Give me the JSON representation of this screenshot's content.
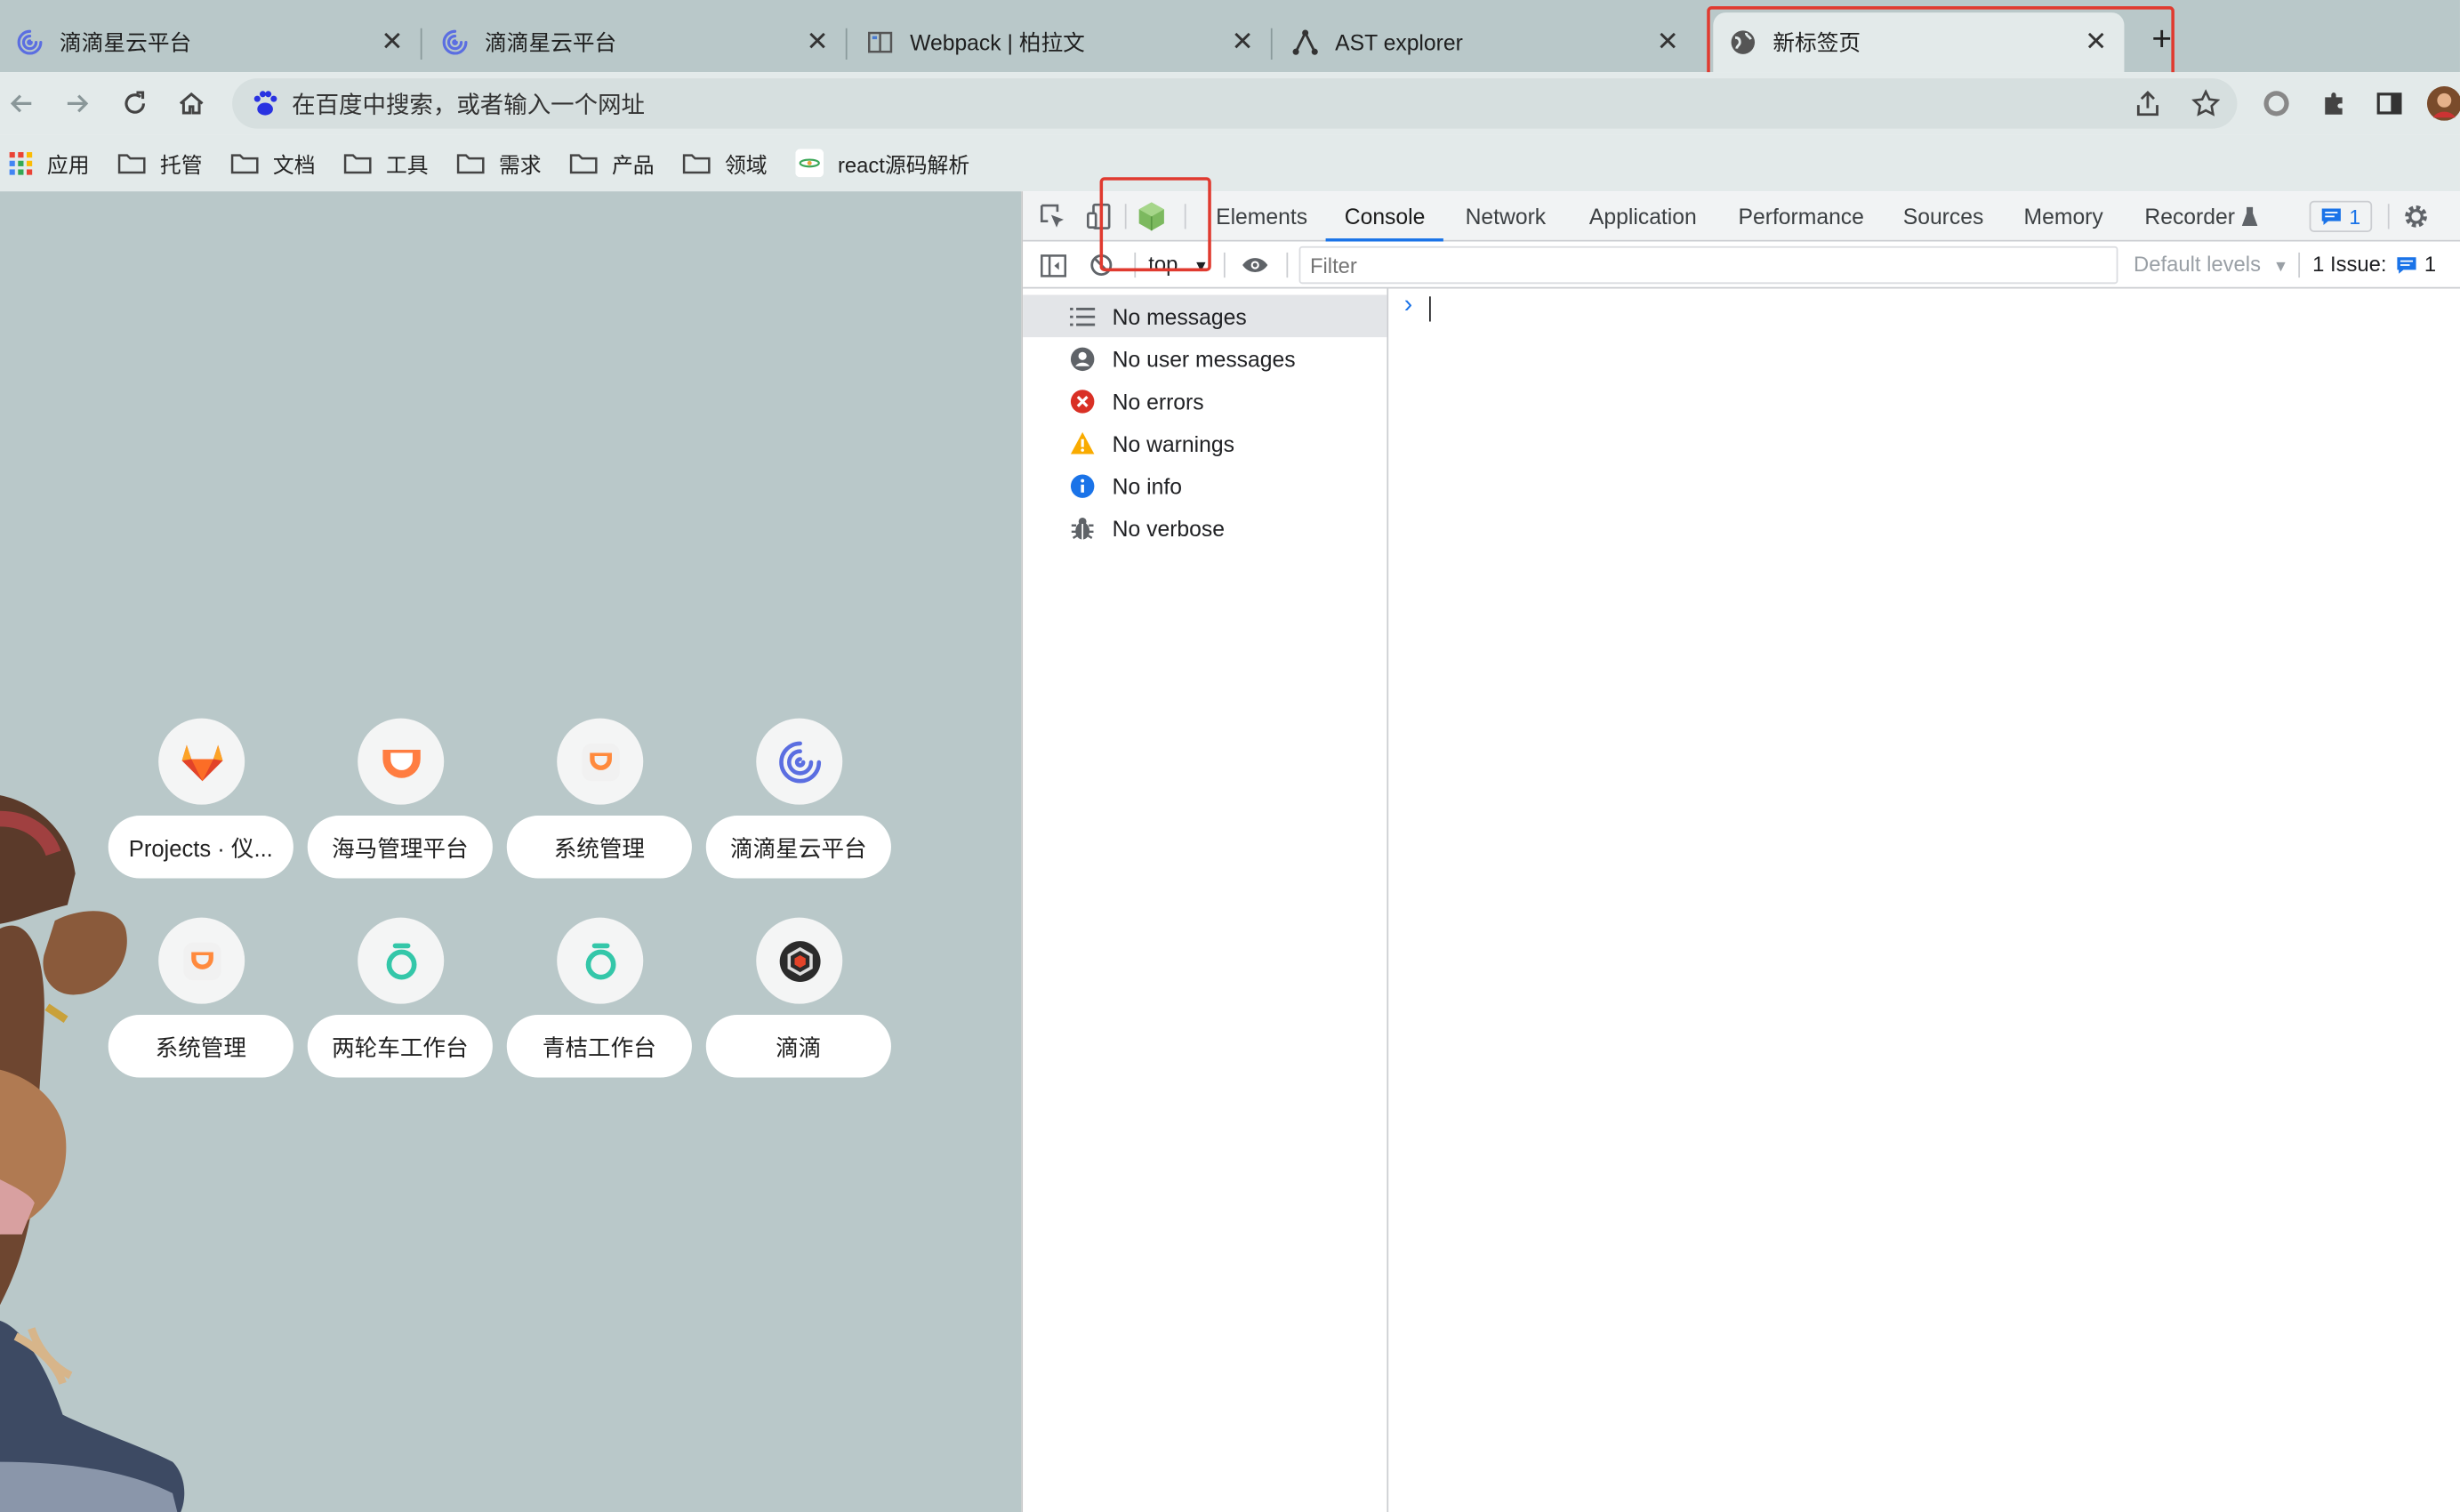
{
  "tabs": [
    {
      "title": "滴滴星云平台",
      "icon": "spiral-logo-icon"
    },
    {
      "title": "滴滴星云平台",
      "icon": "spiral-logo-icon"
    },
    {
      "title": "Webpack | 柏拉文",
      "icon": "book-icon"
    },
    {
      "title": "AST explorer",
      "icon": "tree-nodes-icon"
    },
    {
      "title": "新标签页",
      "icon": "globe-icon",
      "active": true
    }
  ],
  "omnibox": {
    "placeholder": "在百度中搜索，或者输入一个网址"
  },
  "bookmarks": [
    "应用",
    "托管",
    "文档",
    "工具",
    "需求",
    "产品",
    "领域",
    "react源码解析"
  ],
  "shortcuts": [
    {
      "label": "Projects · 仪...",
      "icon": "gitlab-fox-icon"
    },
    {
      "label": "海马管理平台",
      "icon": "didi-logo-icon"
    },
    {
      "label": "系统管理",
      "icon": "didi-logo-icon"
    },
    {
      "label": "滴滴星云平台",
      "icon": "spiral-logo-icon"
    },
    {
      "label": "系统管理",
      "icon": "didi-logo-icon"
    },
    {
      "label": "两轮车工作台",
      "icon": "qingju-logo-icon"
    },
    {
      "label": "青桔工作台",
      "icon": "qingju-logo-icon"
    },
    {
      "label": "滴滴",
      "icon": "dark-circle-logo-icon"
    }
  ],
  "devtools": {
    "tabs": [
      "Elements",
      "Console",
      "Network",
      "Application",
      "Performance",
      "Sources",
      "Memory",
      "Recorder"
    ],
    "active_tab": "Console",
    "message_count": "1",
    "context": "top",
    "filter_placeholder": "Filter",
    "levels": "Default levels",
    "issues_label": "1 Issue:",
    "issues_count": "1",
    "sidebar": [
      {
        "label": "No messages",
        "icon": "list-icon"
      },
      {
        "label": "No user messages",
        "icon": "user-circle-icon"
      },
      {
        "label": "No errors",
        "icon": "error-icon"
      },
      {
        "label": "No warnings",
        "icon": "warning-icon"
      },
      {
        "label": "No info",
        "icon": "info-icon"
      },
      {
        "label": "No verbose",
        "icon": "bug-icon"
      }
    ],
    "prompt": "›"
  },
  "colors": {
    "highlight_box": "#e03a2f",
    "ntp_background": "#b9c8c9",
    "devtools_accent": "#1a73e8"
  }
}
